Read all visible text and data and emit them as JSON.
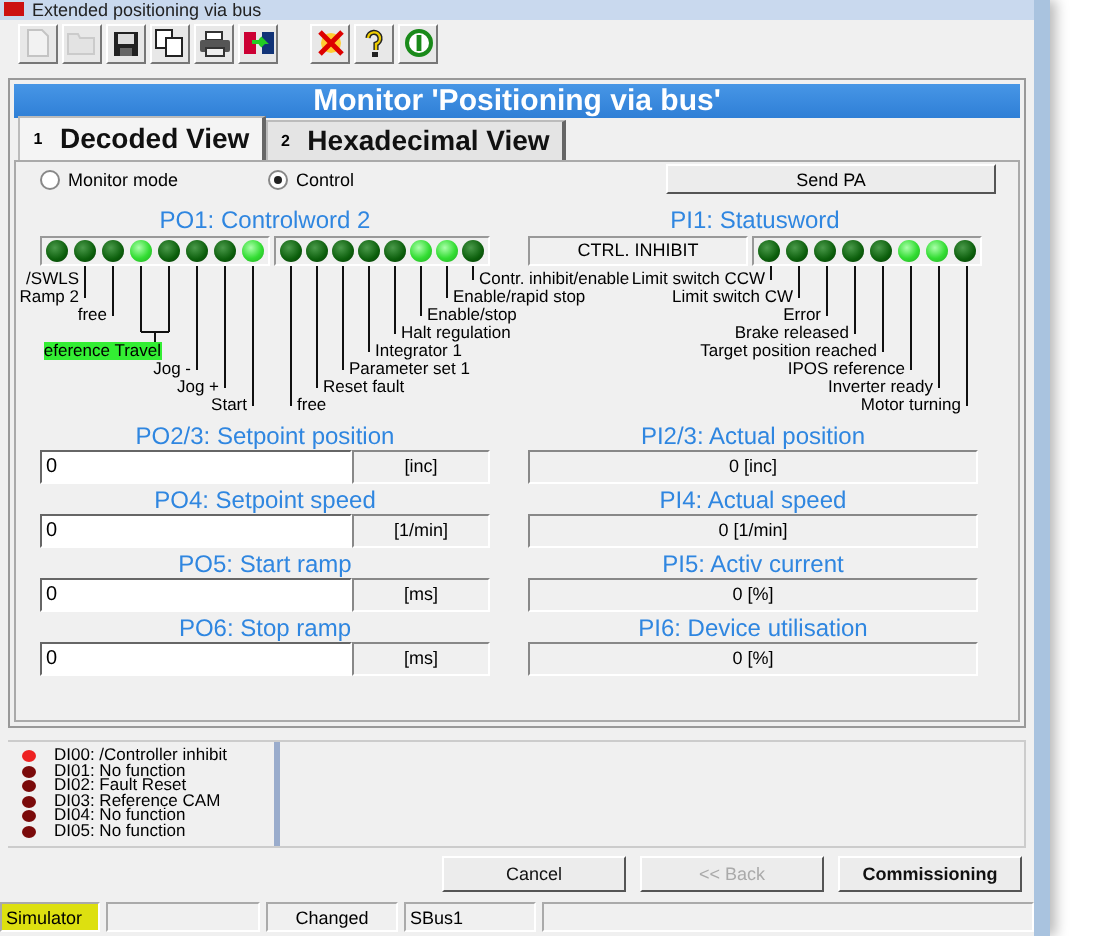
{
  "window": {
    "title": "Extended positioning via bus"
  },
  "toolbar": [
    {
      "kind": "new",
      "disabled": true
    },
    {
      "kind": "open",
      "disabled": true
    },
    {
      "kind": "save",
      "disabled": false
    },
    {
      "kind": "copy",
      "disabled": false
    },
    {
      "kind": "print",
      "disabled": false
    },
    {
      "kind": "transfer",
      "disabled": false
    },
    {
      "kind": "cancel",
      "disabled": false
    },
    {
      "kind": "help",
      "disabled": false
    },
    {
      "kind": "info",
      "disabled": false
    }
  ],
  "header": {
    "title": "Monitor 'Positioning via bus'"
  },
  "tabs": [
    {
      "badge": "1",
      "label": "Decoded View",
      "selected": true
    },
    {
      "badge": "2",
      "label": "Hexadecimal View",
      "selected": false
    }
  ],
  "mode": {
    "options": [
      {
        "label": "Monitor mode",
        "selected": false
      },
      {
        "label": "Control",
        "selected": true
      }
    ],
    "send_button": "Send PA"
  },
  "po1": {
    "title": "PO1: Controlword 2",
    "groups": [
      {
        "leds": [
          {
            "on": false
          },
          {
            "on": false
          },
          {
            "on": false
          },
          {
            "on": true
          },
          {
            "on": false
          },
          {
            "on": false
          },
          {
            "on": false
          },
          {
            "on": true
          }
        ],
        "labels": [
          {
            "text": "/SWLS",
            "highlighted": false
          },
          {
            "text": "Ramp 2",
            "highlighted": false
          },
          {
            "text": "free",
            "highlighted": false
          },
          {
            "text": "eference Travel",
            "highlighted": true
          },
          {
            "text": "Jog -",
            "highlighted": false
          },
          {
            "text": "Jog +",
            "highlighted": false
          },
          {
            "text": "Start",
            "highlighted": false
          }
        ]
      },
      {
        "leds": [
          {
            "on": false
          },
          {
            "on": false
          },
          {
            "on": false
          },
          {
            "on": false
          },
          {
            "on": false
          },
          {
            "on": true
          },
          {
            "on": true
          },
          {
            "on": false
          }
        ],
        "labels": [
          {
            "text": "Contr. inhibit/enable",
            "highlighted": false
          },
          {
            "text": "Enable/rapid stop",
            "highlighted": false
          },
          {
            "text": "Enable/stop",
            "highlighted": false
          },
          {
            "text": "Halt regulation",
            "highlighted": false
          },
          {
            "text": "Integrator 1",
            "highlighted": false
          },
          {
            "text": "Parameter set 1",
            "highlighted": false
          },
          {
            "text": "Reset fault",
            "highlighted": false
          },
          {
            "text": "free",
            "highlighted": false
          }
        ]
      }
    ]
  },
  "pi1": {
    "title": "PI1: Statusword",
    "state": "CTRL. INHIBIT",
    "leds": [
      {
        "on": false
      },
      {
        "on": false
      },
      {
        "on": false
      },
      {
        "on": false
      },
      {
        "on": false
      },
      {
        "on": true
      },
      {
        "on": true
      },
      {
        "on": false
      }
    ],
    "labels": [
      {
        "text": "Limit switch CCW"
      },
      {
        "text": "Limit switch CW"
      },
      {
        "text": "Error"
      },
      {
        "text": "Brake released"
      },
      {
        "text": "Target position reached"
      },
      {
        "text": "IPOS reference"
      },
      {
        "text": "Inverter ready"
      },
      {
        "text": "Motor turning"
      }
    ]
  },
  "outputs": [
    {
      "title": "PO2/3: Setpoint position",
      "value": "0",
      "unit": "[inc]"
    },
    {
      "title": "PO4: Setpoint speed",
      "value": "0",
      "unit": "[1/min]"
    },
    {
      "title": "PO5: Start ramp",
      "value": "0",
      "unit": "[ms]"
    },
    {
      "title": "PO6: Stop ramp",
      "value": "0",
      "unit": "[ms]"
    }
  ],
  "inputs": [
    {
      "title": "PI2/3: Actual position",
      "value": "0 [inc]"
    },
    {
      "title": "PI4: Actual speed",
      "value": "0 [1/min]"
    },
    {
      "title": "PI5: Activ current",
      "value": "0 [%]"
    },
    {
      "title": "PI6: Device utilisation",
      "value": "0 [%]"
    }
  ],
  "digital_inputs": [
    {
      "label": "DI00: /Controller inhibit",
      "on": true
    },
    {
      "label": "DI01: No function",
      "on": false
    },
    {
      "label": "DI02: Fault Reset",
      "on": false
    },
    {
      "label": "DI03: Reference CAM",
      "on": false
    },
    {
      "label": "DI04: No function",
      "on": false
    },
    {
      "label": "DI05: No function",
      "on": false
    }
  ],
  "buttons": [
    {
      "label": "Cancel",
      "disabled": false,
      "default": false
    },
    {
      "label": "<< Back",
      "disabled": true,
      "default": false
    },
    {
      "label": "Commissioning",
      "disabled": false,
      "default": true
    }
  ],
  "status_bar": {
    "mode": "Simulator",
    "state": "Changed",
    "bus": "SBus1"
  }
}
